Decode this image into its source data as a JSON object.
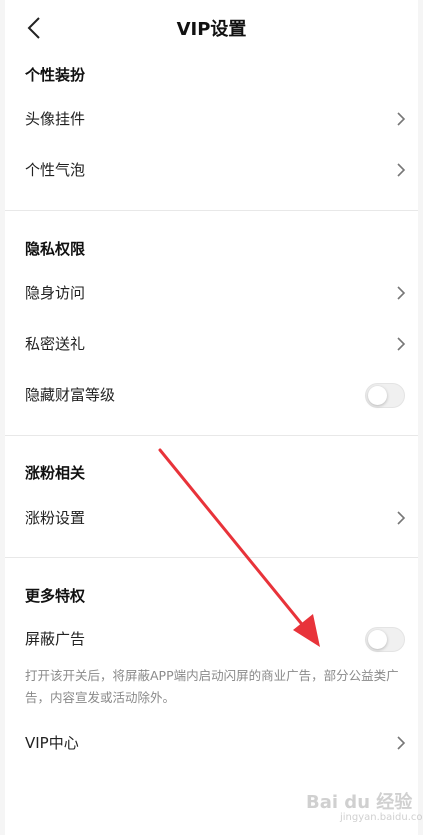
{
  "header": {
    "title": "VIP设置"
  },
  "sections": {
    "style": {
      "title": "个性装扮",
      "items": [
        "头像挂件",
        "个性气泡"
      ]
    },
    "privacy": {
      "title": "隐私权限",
      "items": [
        "隐身访问",
        "私密送礼"
      ],
      "toggle_label": "隐藏财富等级"
    },
    "fans": {
      "title": "涨粉相关",
      "items": [
        "涨粉设置"
      ]
    },
    "more": {
      "title": "更多特权",
      "toggle_label": "屏蔽广告",
      "description": "打开该开关后，将屏蔽APP端内启动闪屏的商业广告，部分公益类广告，内容宣发或活动除外。",
      "items": [
        "VIP中心"
      ]
    }
  },
  "watermark": {
    "text": "Bai du 经验",
    "sub": "jingyan.baidu.com"
  },
  "colors": {
    "annotation_arrow": "#e8333a",
    "background": "#f5f5f5"
  }
}
